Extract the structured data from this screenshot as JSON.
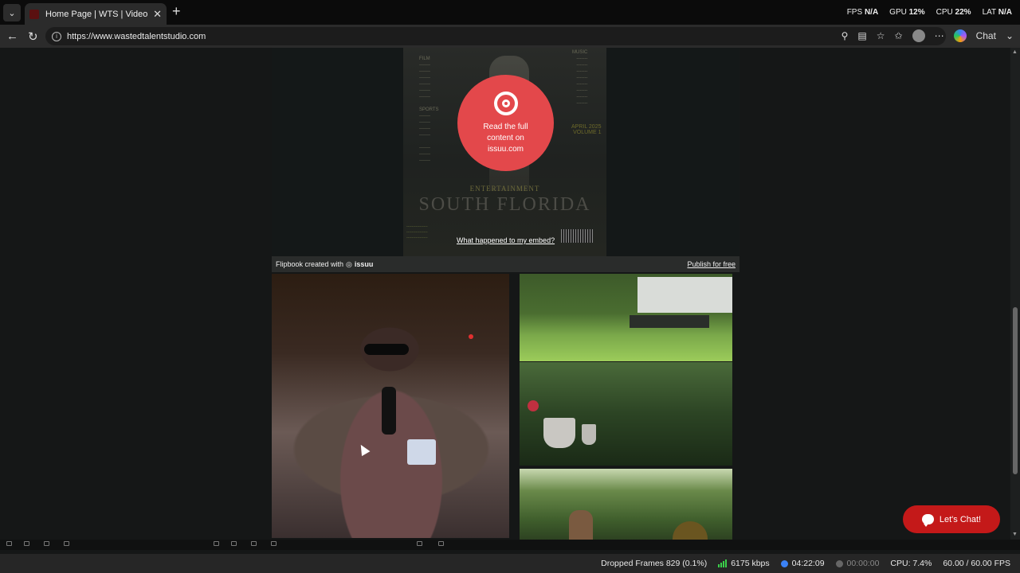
{
  "browser": {
    "tab_title": "Home Page | WTS | Video Services",
    "url": "https://www.wastedtalentstudio.com",
    "chat_label": "Chat"
  },
  "overlay": {
    "fps_label": "FPS",
    "fps_value": "N/A",
    "gpu_label": "GPU",
    "gpu_value": "12%",
    "cpu_label": "CPU",
    "cpu_value": "22%",
    "lat_label": "LAT",
    "lat_value": "N/A"
  },
  "embed": {
    "read_text": "Read the full content on issuu.com",
    "help_link": "What happened to my embed?",
    "created_with": "Flipbook created with",
    "brand": "issuu",
    "publish": "Publish for free",
    "cover": {
      "kicker": "ENTERTAINMENT",
      "headline": "SOUTH FLORIDA",
      "date": "APRIL 2025",
      "volume": "VOLUME 1"
    }
  },
  "chat_widget": {
    "label": "Let's Chat!"
  },
  "status": {
    "dropped_frames": "Dropped Frames 829 (0.1%)",
    "bitrate": "6175 kbps",
    "stream_time": "04:22:09",
    "rec_time": "00:00:00",
    "cpu": "CPU: 7.4%",
    "fps": "60.00 / 60.00 FPS"
  },
  "colors": {
    "issuu_red": "#e3484b",
    "chat_red": "#c41919",
    "page_bg": "#151717"
  }
}
